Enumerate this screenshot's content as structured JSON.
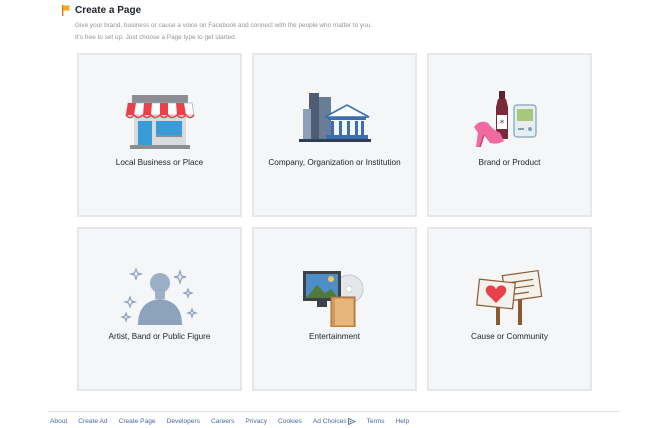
{
  "header": {
    "title": "Create a Page",
    "subtitle_1": "Give your brand, business or cause a voice on Facebook and connect with the people who matter to you.",
    "subtitle_2": "It's free to set up. Just choose a Page type to get started."
  },
  "tiles": [
    {
      "label": "Local Business or Place",
      "icon": "storefront-icon"
    },
    {
      "label": "Company, Organization or Institution",
      "icon": "company-buildings-icon"
    },
    {
      "label": "Brand or Product",
      "icon": "brand-products-icon"
    },
    {
      "label": "Artist, Band or Public Figure",
      "icon": "public-figure-icon"
    },
    {
      "label": "Entertainment",
      "icon": "entertainment-media-icon"
    },
    {
      "label": "Cause or Community",
      "icon": "cause-signs-icon"
    }
  ],
  "footer": {
    "links": [
      "About",
      "Create Ad",
      "Create Page",
      "Developers",
      "Careers",
      "Privacy",
      "Cookies",
      "Ad Choices",
      "Terms",
      "Help"
    ]
  },
  "colors": {
    "link": "#4b67a1",
    "tile_bg": "#f5f6f7",
    "tile_border": "#e5e7ea",
    "subtitle": "#90949c",
    "flag": "#f5a623"
  }
}
